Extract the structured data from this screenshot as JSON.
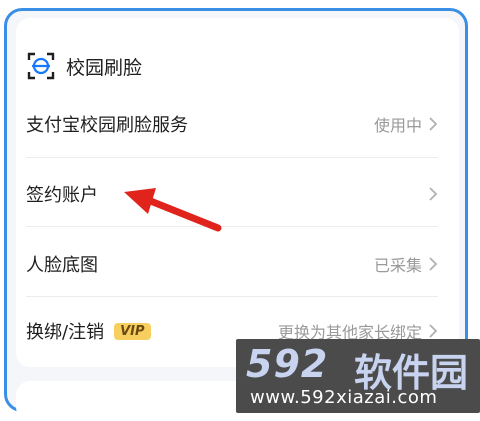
{
  "section": {
    "title": "校园刷脸",
    "icon": "face-scan-icon"
  },
  "rows": [
    {
      "label": "支付宝校园刷脸服务",
      "value": "使用中"
    },
    {
      "label": "签约账户",
      "value": ""
    },
    {
      "label": "人脸底图",
      "value": "已采集"
    },
    {
      "label": "换绑/注销",
      "badge": "VIP",
      "value": "更换为其他家长绑定"
    }
  ],
  "watermark": {
    "brand": "592",
    "name": "软件园",
    "url": "www.592xiazai.com"
  },
  "colors": {
    "frame": "#3a8ee6",
    "arrow": "#e0241b",
    "vip": "#f6cf5e"
  }
}
